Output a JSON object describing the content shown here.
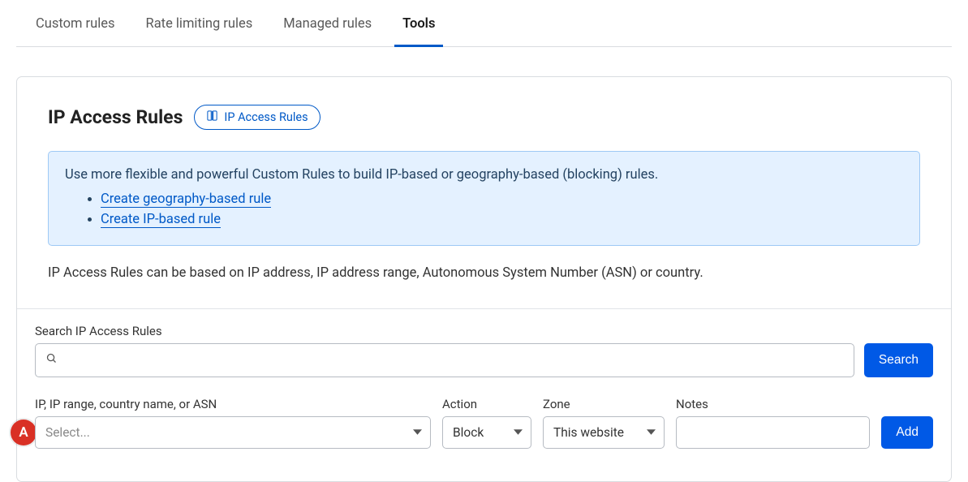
{
  "tabs": {
    "custom": "Custom rules",
    "rate": "Rate limiting rules",
    "managed": "Managed rules",
    "tools": "Tools"
  },
  "title": "IP Access Rules",
  "doc_chip": "IP Access Rules",
  "banner": {
    "lead": "Use more flexible and powerful Custom Rules to build IP-based or geography-based (blocking) rules.",
    "link_geo": "Create geography-based rule",
    "link_ip": "Create IP-based rule"
  },
  "description": "IP Access Rules can be based on IP address, IP address range, Autonomous System Number (ASN) or country.",
  "search": {
    "label": "Search IP Access Rules",
    "button": "Search"
  },
  "form": {
    "ip_label": "IP, IP range, country name, or ASN",
    "ip_placeholder": "Select...",
    "action_label": "Action",
    "action_value": "Block",
    "zone_label": "Zone",
    "zone_value": "This website",
    "notes_label": "Notes",
    "add_button": "Add"
  },
  "marker": "A"
}
